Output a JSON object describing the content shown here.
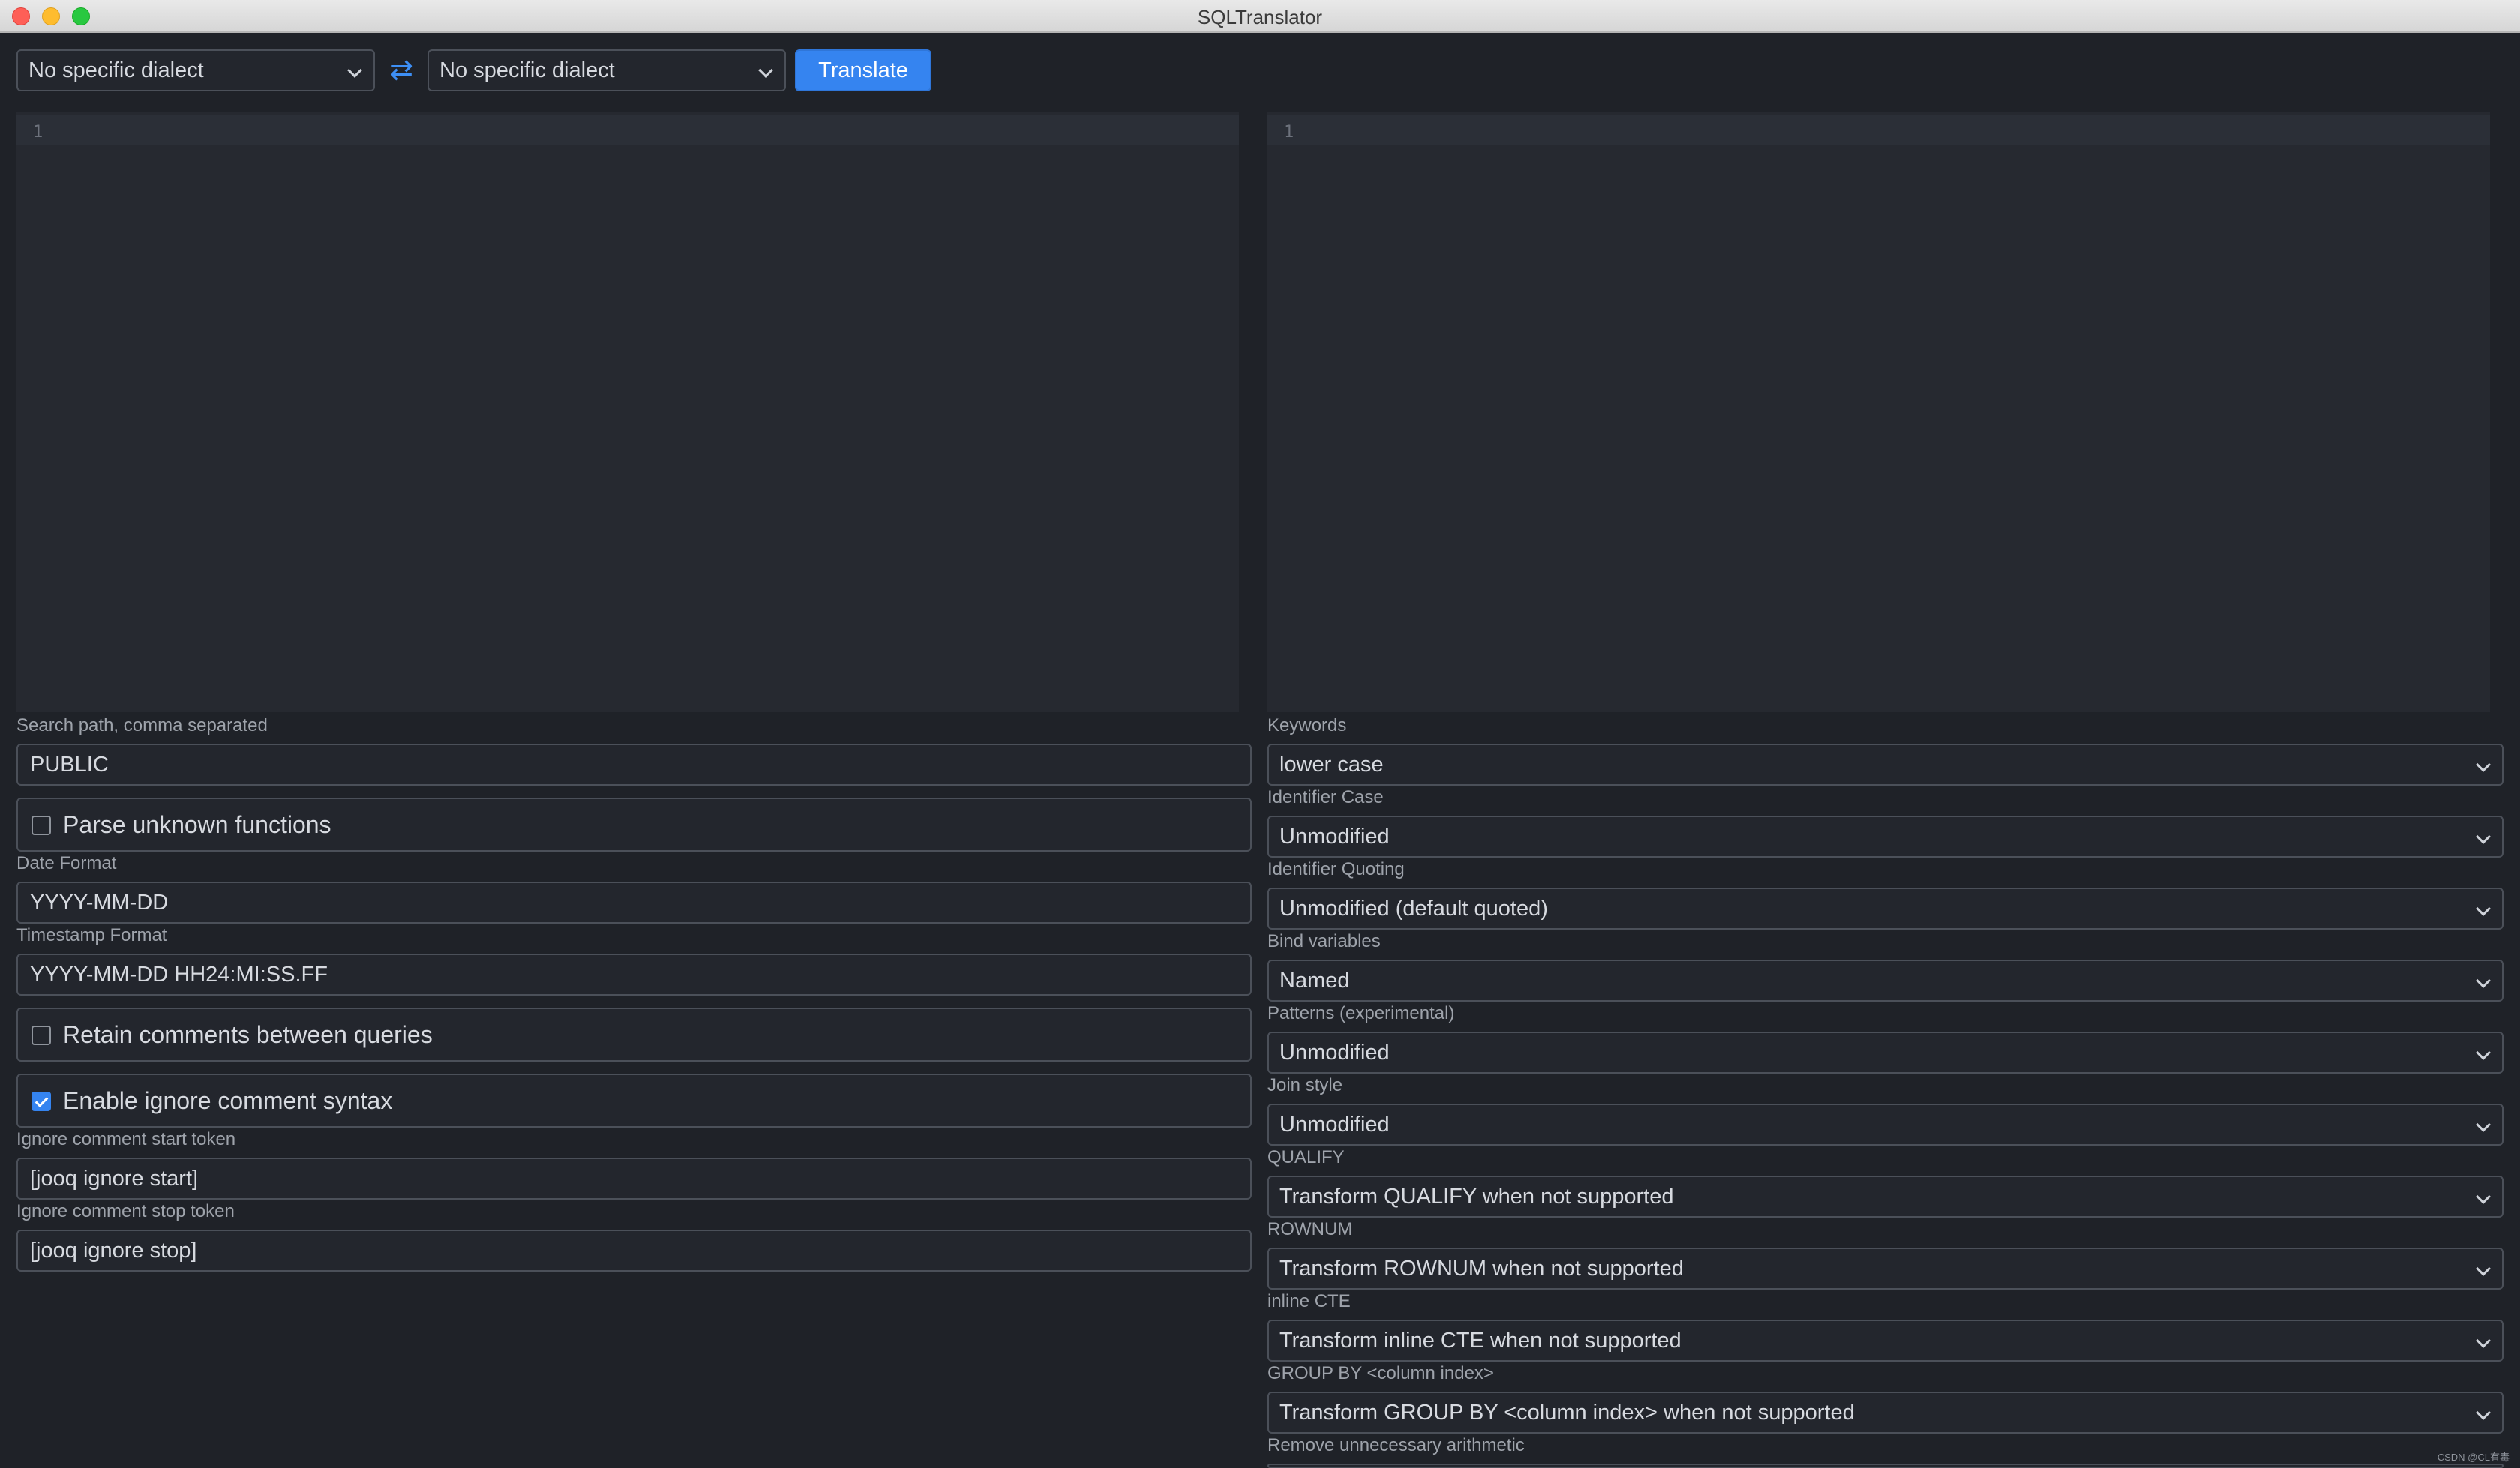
{
  "window": {
    "title": "SQLTranslator"
  },
  "toolbar": {
    "source_dialect": "No specific dialect",
    "target_dialect": "No specific dialect",
    "swap_icon": "swap-arrows-icon",
    "translate_label": "Translate"
  },
  "editors": {
    "input": {
      "line_number": "1"
    },
    "output": {
      "line_number": "1"
    }
  },
  "left_options": {
    "search_path_label": "Search path, comma separated",
    "search_path_value": "PUBLIC",
    "parse_unknown_functions": {
      "label": "Parse unknown functions",
      "checked": false
    },
    "date_format_label": "Date Format",
    "date_format_value": "YYYY-MM-DD",
    "timestamp_format_label": "Timestamp Format",
    "timestamp_format_value": "YYYY-MM-DD HH24:MI:SS.FF",
    "retain_comments": {
      "label": "Retain comments between queries",
      "checked": false
    },
    "ignore_comment_syntax": {
      "label": "Enable ignore comment syntax",
      "checked": true
    },
    "ignore_start_label": "Ignore comment start token",
    "ignore_start_value": "[jooq ignore start]",
    "ignore_stop_label": "Ignore comment stop token",
    "ignore_stop_value": "[jooq ignore stop]"
  },
  "right_options": {
    "keywords_label": "Keywords",
    "keywords_value": "lower case",
    "identifier_case_label": "Identifier Case",
    "identifier_case_value": "Unmodified",
    "identifier_quoting_label": "Identifier Quoting",
    "identifier_quoting_value": "Unmodified (default quoted)",
    "bind_variables_label": "Bind variables",
    "bind_variables_value": "Named",
    "patterns_label": "Patterns (experimental)",
    "patterns_value": "Unmodified",
    "join_style_label": "Join style",
    "join_style_value": "Unmodified",
    "qualify_label": "QUALIFY",
    "qualify_value": "Transform QUALIFY when not supported",
    "rownum_label": "ROWNUM",
    "rownum_value": "Transform ROWNUM when not supported",
    "inline_cte_label": "inline CTE",
    "inline_cte_value": "Transform inline CTE when not supported",
    "group_by_label": "GROUP BY <column index>",
    "group_by_value": "Transform GROUP BY <column index> when not supported",
    "remove_arith_label": "Remove unnecessary arithmetic"
  },
  "watermark": "CSDN @CL有毒"
}
